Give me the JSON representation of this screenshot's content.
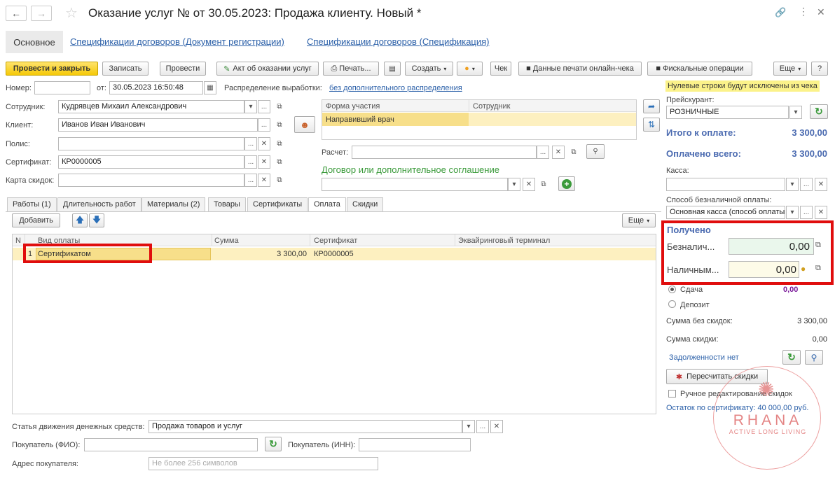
{
  "window": {
    "title": "Оказание услуг №  от 30.05.2023: Продажа клиенту.  Новый *"
  },
  "nav_tabs": [
    "Основное",
    "Спецификации договоров (Документ регистрации)",
    "Спецификации договоров (Спецификация)"
  ],
  "toolbar": {
    "post_close": "Провести и закрыть",
    "save": "Записать",
    "post": "Провести",
    "act": "Акт об оказании услуг",
    "print": "Печать...",
    "create": "Создать",
    "check": "Чек",
    "print_data": "Данные печати онлайн-чека",
    "fiscal": "Фискальные операции",
    "more": "Еще",
    "help": "?"
  },
  "header": {
    "number_label": "Номер:",
    "from_label": "от:",
    "date_value": "30.05.2023 16:50:48",
    "distribution_label": "Распределение выработки:",
    "distribution_link": "без дополнительного распределения",
    "null_lines_note": "Нулевые строки будут исключены из чека"
  },
  "fields": {
    "employee_label": "Сотрудник:",
    "employee_value": "Кудрявцев Михаил Александрович",
    "client_label": "Клиент:",
    "client_value": "Иванов Иван Иванович",
    "policy_label": "Полис:",
    "certificate_label": "Сертификат:",
    "certificate_value": "КР0000005",
    "discount_card_label": "Карта скидок:",
    "settlement_label": "Расчет:",
    "contract_title": "Договор или дополнительное соглашение"
  },
  "participation_table": {
    "headers": [
      "Форма участия",
      "Сотрудник"
    ],
    "rows": [
      [
        "Направивший врач",
        ""
      ]
    ]
  },
  "right_panel": {
    "pricelist_label": "Прейскурант:",
    "pricelist_value": "РОЗНИЧНЫЕ",
    "total_label": "Итого к оплате:",
    "total_value": "3 300,00",
    "paid_label": "Оплачено всего:",
    "paid_value": "3 300,00",
    "cashbox_label": "Касса:",
    "cashless_method_label": "Способ безналичной оплаты:",
    "cashless_method_value": "Основная касса (способ оплаты",
    "received_title": "Получено",
    "cashless_label": "Безналич...",
    "cashless_value": "0,00",
    "cash_label": "Наличным...",
    "cash_value": "0,00",
    "change_label": "Сдача",
    "change_value": "0,00",
    "deposit_label": "Депозит",
    "sum_no_discount_label": "Сумма без скидок:",
    "sum_no_discount_value": "3 300,00",
    "discount_sum_label": "Сумма скидки:",
    "discount_sum_value": "0,00",
    "no_debts": "Задолженности нет",
    "recalc_button": "Пересчитать скидки",
    "manual_discount_label": "Ручное редактирование скидок",
    "certificate_balance": "Остаток по сертификату: 40 000,00 руб."
  },
  "doc_tabs": [
    "Работы (1)",
    "Длительность работ",
    "Материалы (2)",
    "Товары",
    "Сертификаты",
    "Оплата",
    "Скидки"
  ],
  "payment_table": {
    "add_button": "Добавить",
    "more": "Еще",
    "headers": [
      "N",
      "Вид оплаты",
      "Сумма",
      "Сертификат",
      "Эквайринговый терминал"
    ],
    "rows": [
      [
        "1",
        "Сертификатом",
        "3 300,00",
        "КР0000005",
        ""
      ]
    ]
  },
  "bottom": {
    "cash_flow_label": "Статья движения денежных средств:",
    "cash_flow_value": "Продажа товаров и услуг",
    "buyer_name_label": "Покупатель (ФИО):",
    "buyer_inn_label": "Покупатель (ИНН):",
    "buyer_address_label": "Адрес покупателя:",
    "buyer_address_placeholder": "Не более 256 символов"
  },
  "watermark": {
    "brand": "RHANA",
    "tagline": "ACTIVE LONG LIVING"
  },
  "colors": {
    "accent_red": "#e00d0d",
    "link_blue": "#2a5fa8",
    "row_yellow": "#fdf0c0",
    "green": "#3a9a3a"
  }
}
